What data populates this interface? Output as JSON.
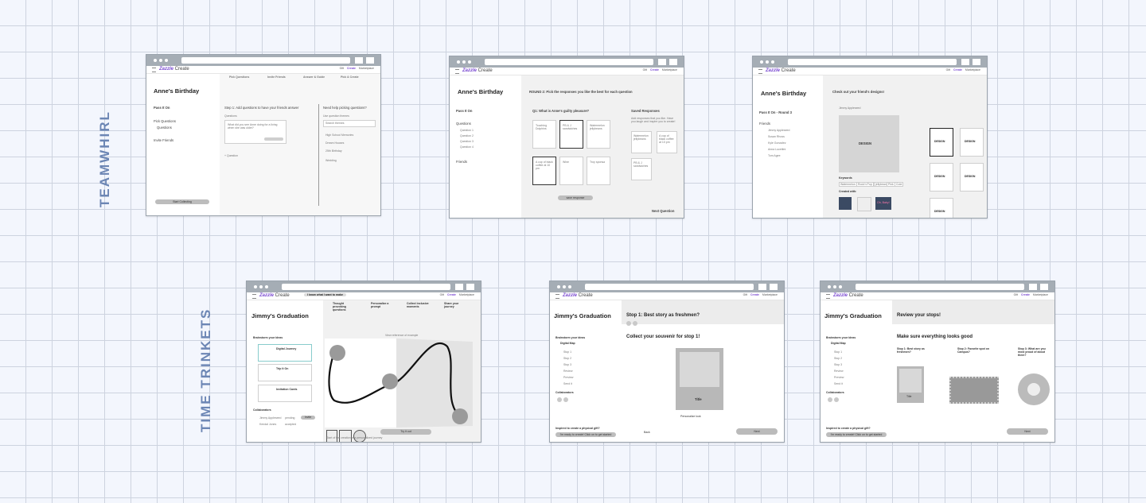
{
  "row_labels": {
    "top": "TEAMWHIRL",
    "bottom": "TIME TRINKETS"
  },
  "brand": {
    "name": "Zazzle",
    "suffix": " Create",
    "accent": "#7b4bd1"
  },
  "nav_links": [
    "Gift",
    "Create",
    "Marketplace"
  ],
  "screens": {
    "a": {
      "title": "Anne's Birthday",
      "mode": "Pass It On",
      "steps": [
        "Pick Questions",
        "Invite Friends",
        "Answer & Guide",
        "Pick & Create"
      ],
      "sidebar": [
        "Pick Questions",
        "Questions",
        "Invite Friends"
      ],
      "main_heading": "Step 1: Add questions to have your friends answer",
      "questions_label": "Questions",
      "question_text": "What did you see Anne doing for a living when she was older?",
      "add_label": "+ Question",
      "help_heading": "Need help picking questions?",
      "help_sub": "Use question themes",
      "search_placeholder": "Search themes",
      "themes": [
        "High School Memories",
        "Dream Houses",
        "25th Birthday",
        "Wedding"
      ],
      "start_button": "Start Collecting"
    },
    "b": {
      "title": "Anne's Birthday",
      "mode": "Pass It On",
      "sidebar": [
        "Questions",
        "Question 1",
        "Question 2",
        "Question 3",
        "Question 4",
        "Friends"
      ],
      "round_heading": "ROUND 2: Pick the responses you like the best for each question",
      "question": "Q1: What is Anne's guilty pleasure?",
      "responses": [
        "Touching Dolphins",
        "PB & J sandwiches",
        "Watermelon jellybeans",
        "A cup of black coffee at 10 pm",
        "Wine",
        "Troy sponsa"
      ],
      "saved_heading": "Saved Responses",
      "saved_desc": "Add responses that you like. Have you laugh and inspire you to create!",
      "saved": [
        "Watermelon jellybeans",
        "A cup of black coffee at 10 pm",
        "PB & J sandwiches"
      ],
      "save_button": "save response",
      "next": "Next Question"
    },
    "c": {
      "title": "Anne's Birthday",
      "mode": "Pass It On - Round 3",
      "friends_label": "Friends",
      "friends": [
        "Jimmy Appleseed",
        "Susan Rhoss",
        "Kyle Gonzalez",
        "Anna Lucettini",
        "Tom Agee"
      ],
      "heading": "Check out your friend's designs!",
      "designer": "Jimmy Appleseed",
      "design_label": "DESIGN",
      "keywords_label": "Keywords",
      "keywords": [
        "Watermelon",
        "Rock'n Pop",
        "jellybean",
        "Pink",
        "Cute"
      ],
      "created_label": "Created with:",
      "thumb_text": "Oh, Baby!"
    },
    "d": {
      "title": "Jimmy's Graduation",
      "pill": "I know what I want to make",
      "steps": [
        "Thought provoking questions",
        "Personalize a prompt",
        "Collect inclusive moments",
        "Share your journey"
      ],
      "brainstorm": "Brainstorm your ideas",
      "options": [
        "Digital Journey",
        "Trip It On",
        "Invitation Cards"
      ],
      "collaborators": "Collaborators",
      "people": [
        "Jimmy Appleseed",
        "Kendal Jones"
      ],
      "status": [
        "pending",
        "accepted"
      ],
      "invite": "Invite",
      "map_title": "View reference of example",
      "try_button": "Try it out",
      "footer": "Start of the creation in a personalized journey"
    },
    "e": {
      "title": "Jimmy's Graduation",
      "heading": "Stop 1: Best story as freshmen?",
      "brainstorm": "Brainstorm your ideas",
      "sub": "Digital Map",
      "stops": [
        "Stop 1",
        "Stop 2",
        "Stop 3",
        "Review",
        "Preview",
        "Send it"
      ],
      "collaborators": "Collaborators",
      "souvenir": "Collect your souvenir for stop 1!",
      "card_title": "Title",
      "personalize": "Personalize look",
      "back": "Back",
      "next": "Next",
      "gift_heading": "Inspired to create a physical gift?",
      "gift_button": "I'm ready to create! Click on to get started"
    },
    "f": {
      "title": "Jimmy's Graduation",
      "heading": "Review your stops!",
      "sub": "Make sure everything looks good",
      "stop_titles": [
        "Stop 1: Best story as freshmen?",
        "Stop 2: Favorite spot on Campus?",
        "Stop 3: What are you most proud of about them?"
      ],
      "card_title": "Title",
      "next": "Next",
      "gift_heading": "Inspired to create a physical gift?",
      "gift_button": "I'm ready to create! Click on to get started"
    }
  }
}
